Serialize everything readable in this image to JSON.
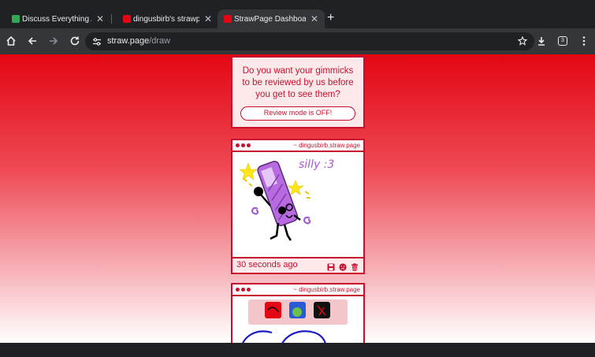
{
  "tabs": [
    {
      "title": "Discuss Everything About B",
      "active": false,
      "favicon_color": "#34a853"
    },
    {
      "title": "dingusbirb's strawpage",
      "active": false,
      "favicon_color": "#e30613"
    },
    {
      "title": "StrawPage Dashboard",
      "active": true,
      "favicon_color": "#e30613"
    }
  ],
  "toolbar": {
    "url_host": "straw.page",
    "url_path": "/draw",
    "tab_count": "3"
  },
  "review": {
    "question": "Do you want your gimmicks to be reviewed by us before you get to see them?",
    "button": "Review mode is OFF!"
  },
  "cards": [
    {
      "host": "~ dingusbirb.straw.page",
      "time": "30 seconds ago",
      "drawing_text": "silly :3"
    },
    {
      "host": "~ dingusbirb.straw.page"
    }
  ],
  "colors": {
    "accent": "#c8102e",
    "page_top": "#e30613"
  }
}
